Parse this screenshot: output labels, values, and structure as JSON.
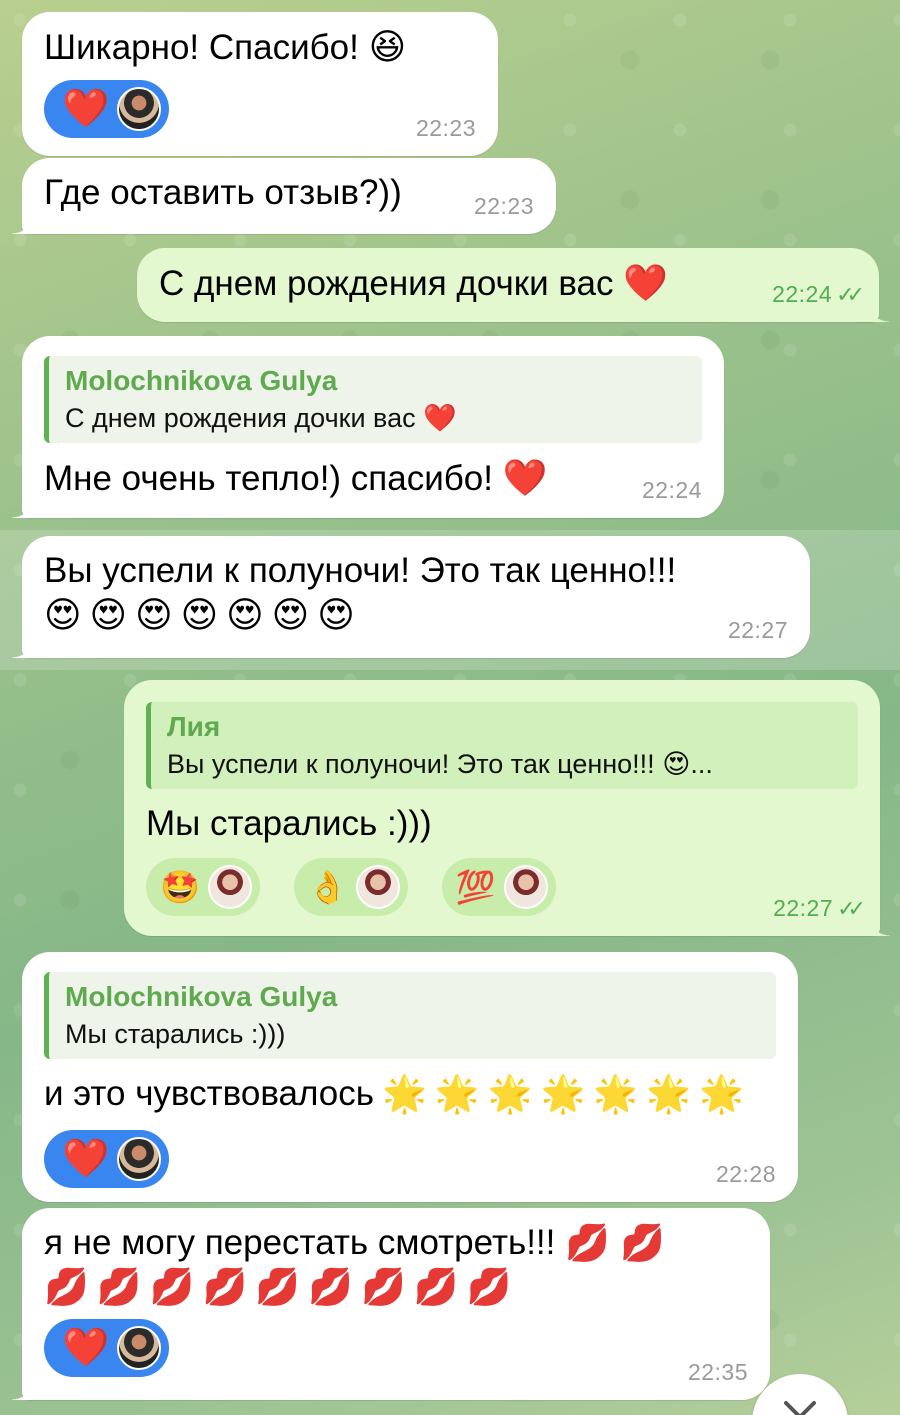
{
  "messages": [
    {
      "text": "Шикарно! Спасибо!",
      "emoji": "😆",
      "time": "22:23",
      "reaction": "❤️"
    },
    {
      "text": "Где оставить отзыв?))",
      "time": "22:23"
    },
    {
      "text": "С днем рождения дочки вас",
      "emoji": "❤️",
      "time": "22:24",
      "ticks": "✓✓"
    },
    {
      "reply_name": "Molochnikova Gulya",
      "reply_text": "С днем рождения дочки вас ❤️",
      "text": "Мне очень тепло!) спасибо!",
      "emoji": "❤️",
      "time": "22:24"
    },
    {
      "text": "Вы успели к полуночи! Это так ценно!!!",
      "emojis": [
        "😍",
        "😍",
        "😍",
        "😍",
        "😍",
        "😍",
        "😍"
      ],
      "time": "22:27"
    },
    {
      "reply_name": "Лия",
      "reply_text": "Вы успели к полуночи! Это так ценно!!! 😍...",
      "text": "Мы старались :)))",
      "reactions": [
        "🤩",
        "👌",
        "💯"
      ],
      "time": "22:27",
      "ticks": "✓✓"
    },
    {
      "reply_name": "Molochnikova Gulya",
      "reply_text": "Мы старались :)))",
      "text": "и это чувствовалось",
      "emojis": [
        "🌟",
        "🌟",
        "🌟",
        "🌟",
        "🌟",
        "🌟",
        "🌟"
      ],
      "time": "22:28",
      "reaction": "❤️"
    },
    {
      "text": "я не могу перестать смотреть!!!",
      "emojis_inline": [
        "💋",
        "💋"
      ],
      "emojis": [
        "💋",
        "💋",
        "💋",
        "💋",
        "💋",
        "💋",
        "💋",
        "💋",
        "💋"
      ],
      "time": "22:35",
      "reaction": "❤️"
    }
  ],
  "scroll_icon": "chevron-down-icon",
  "colors": {
    "incoming": "#ffffff",
    "outgoing": "#e3f8cf",
    "reaction_pill": "#3a86f0",
    "reply_accent": "#5fb153"
  }
}
